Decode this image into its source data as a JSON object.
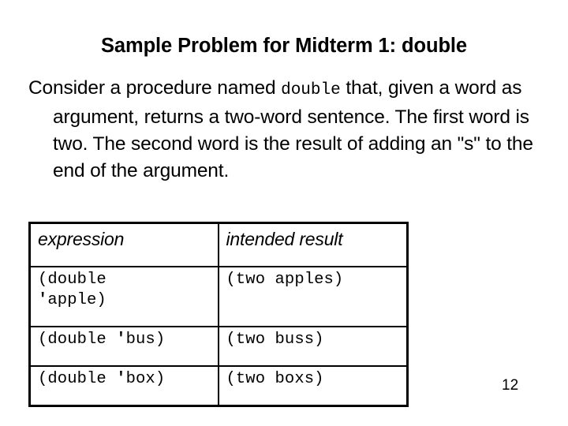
{
  "slide": {
    "title": "Sample Problem for Midterm 1: double",
    "body": {
      "part1": "Consider a procedure named ",
      "code_term": "double",
      "part2": " that, given a word as argument, returns a two-word sentence. The first word is two. The second word is the result of adding an \"s\" to the end of the argument."
    },
    "page_number": "12"
  },
  "table": {
    "headers": {
      "expression": "expression",
      "result": "intended result"
    },
    "rows": [
      {
        "expression": "(double 'apple)",
        "expr_line1": "(double",
        "expr_apos": "'",
        "expr_line2": "apple)",
        "result": "(two apples)"
      },
      {
        "expression": "(double 'bus)",
        "expr_line1": "(double ",
        "expr_apos": "'",
        "expr_line2": "bus)",
        "result": "(two buss)"
      },
      {
        "expression": "(double 'box)",
        "expr_line1": "(double ",
        "expr_apos": "'",
        "expr_line2": "box)",
        "result": "(two boxs)"
      }
    ]
  },
  "colors": {
    "background": "#ffffff",
    "text": "#000000",
    "border": "#000000"
  }
}
